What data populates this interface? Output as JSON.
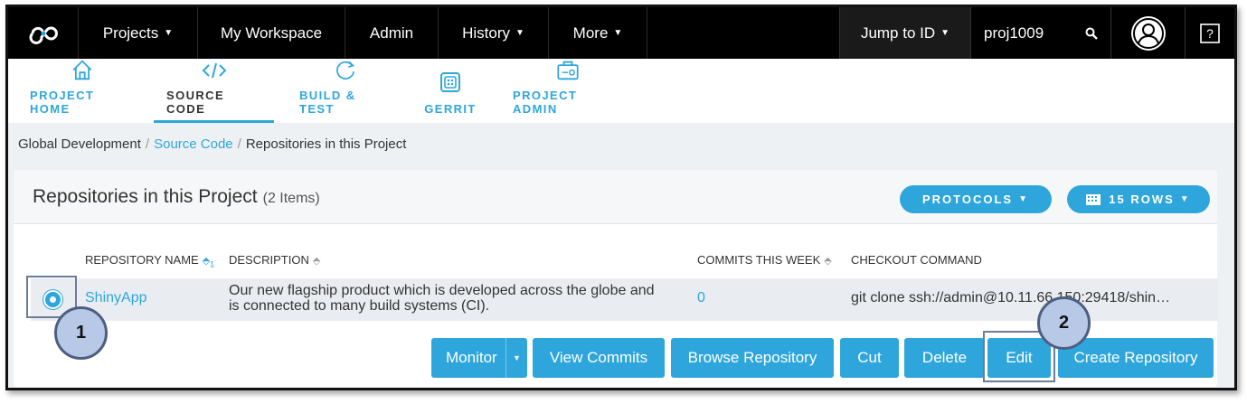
{
  "topnav": {
    "items": [
      {
        "label": "Projects",
        "caret": true
      },
      {
        "label": "My Workspace",
        "caret": false
      },
      {
        "label": "Admin",
        "caret": false
      },
      {
        "label": "History",
        "caret": true
      },
      {
        "label": "More",
        "caret": true
      }
    ],
    "jump_label": "Jump to ID",
    "search_value": "proj1009"
  },
  "subnav": {
    "tabs": [
      {
        "label": "PROJECT HOME",
        "icon": "home-icon"
      },
      {
        "label": "SOURCE CODE",
        "icon": "code-icon",
        "active": true
      },
      {
        "label": "BUILD & TEST",
        "icon": "refresh-icon"
      },
      {
        "label": "GERRIT",
        "icon": "gerrit-icon"
      },
      {
        "label": "PROJECT ADMIN",
        "icon": "briefcase-icon"
      }
    ]
  },
  "breadcrumb": {
    "root": "Global Development",
    "section": "Source Code",
    "current": "Repositories in this Project",
    "separator": "/"
  },
  "panel": {
    "title": "Repositories in this Project",
    "count": "(2 Items)",
    "protocols_label": "PROTOCOLS",
    "rows_label": "15 ROWS",
    "columns": {
      "name": "REPOSITORY NAME",
      "description": "DESCRIPTION",
      "commits": "COMMITS THIS WEEK",
      "checkout": "CHECKOUT COMMAND"
    },
    "sort_rank": "1",
    "row": {
      "name": "ShinyApp",
      "description_line1": "Our new flagship product which is developed across the globe and",
      "description_line2": "is connected to many build systems (CI).",
      "commits": "0",
      "checkout": "git clone ssh://admin@10.11.66.150:29418/shin…"
    }
  },
  "actions": {
    "monitor": "Monitor",
    "view_commits": "View Commits",
    "browse": "Browse Repository",
    "cut": "Cut",
    "delete": "Delete",
    "edit": "Edit",
    "create": "Create Repository"
  },
  "callouts": {
    "first": "1",
    "second": "2"
  },
  "colors": {
    "accent": "#2ea6dc",
    "nav": "#000000",
    "callout": "#b8c9e8"
  }
}
